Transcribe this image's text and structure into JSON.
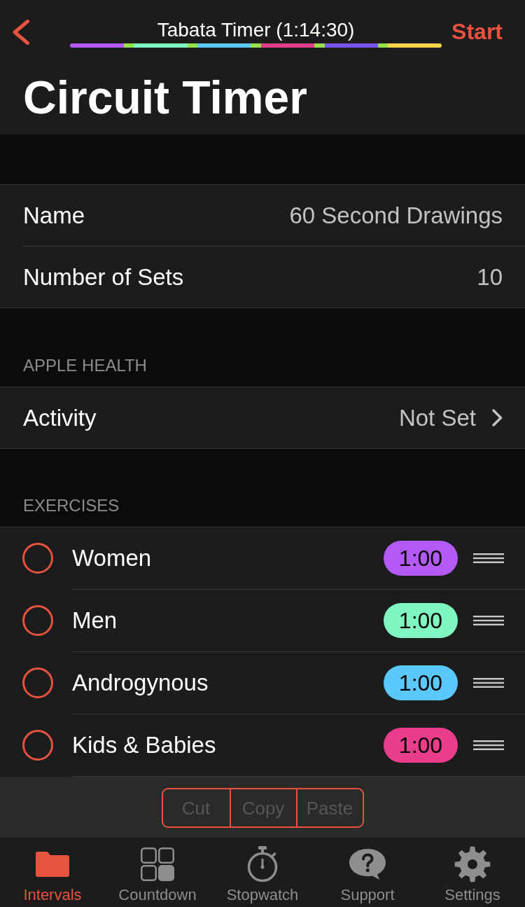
{
  "nav_bar": {
    "title": "Tabata Timer (1:14:30)",
    "start_button": "Start",
    "large_title": "Circuit Timer"
  },
  "timeline": {
    "segments": [
      {
        "kind": "exercise",
        "color": "#b35af5"
      },
      {
        "kind": "rest",
        "color": "#96e04a"
      },
      {
        "kind": "exercise",
        "color": "#80f7c0"
      },
      {
        "kind": "rest",
        "color": "#96e04a"
      },
      {
        "kind": "exercise",
        "color": "#5ac8fa"
      },
      {
        "kind": "rest",
        "color": "#96e04a"
      },
      {
        "kind": "exercise",
        "color": "#e23d8a"
      },
      {
        "kind": "rest",
        "color": "#96e04a"
      },
      {
        "kind": "exercise",
        "color": "#7a55ef"
      },
      {
        "kind": "rest",
        "color": "#96e04a"
      },
      {
        "kind": "exercise",
        "color": "#f7d44c"
      }
    ]
  },
  "settings": [
    {
      "label": "Name",
      "value": "60 Second Drawings"
    },
    {
      "label": "Number of Sets",
      "value": "10"
    }
  ],
  "apple_health": {
    "header": "APPLE HEALTH",
    "rows": [
      {
        "label": "Activity",
        "value": "Not Set",
        "disclosure": true
      }
    ]
  },
  "exercises": {
    "header": "EXERCISES",
    "items": [
      {
        "name": "Women",
        "duration": "1:00",
        "color": "#b35af5",
        "checked": false
      },
      {
        "name": "Men",
        "duration": "1:00",
        "color": "#80f7c0",
        "checked": false
      },
      {
        "name": "Androgynous",
        "duration": "1:00",
        "color": "#5ac8fa",
        "checked": false
      },
      {
        "name": "Kids & Babies",
        "duration": "1:00",
        "color": "#e83e8c",
        "checked": false
      }
    ]
  },
  "edit_menu": [
    {
      "label": "Cut",
      "disabled": true
    },
    {
      "label": "Copy",
      "disabled": true
    },
    {
      "label": "Paste",
      "disabled": true
    }
  ],
  "tab_bar": [
    {
      "label": "Intervals",
      "kind": "folder",
      "selected": true
    },
    {
      "label": "Countdown",
      "kind": "grid",
      "selected": false
    },
    {
      "label": "Stopwatch",
      "kind": "stopwatch",
      "selected": false
    },
    {
      "label": "Support",
      "kind": "question",
      "selected": false
    },
    {
      "label": "Settings",
      "kind": "gear",
      "selected": false
    }
  ]
}
